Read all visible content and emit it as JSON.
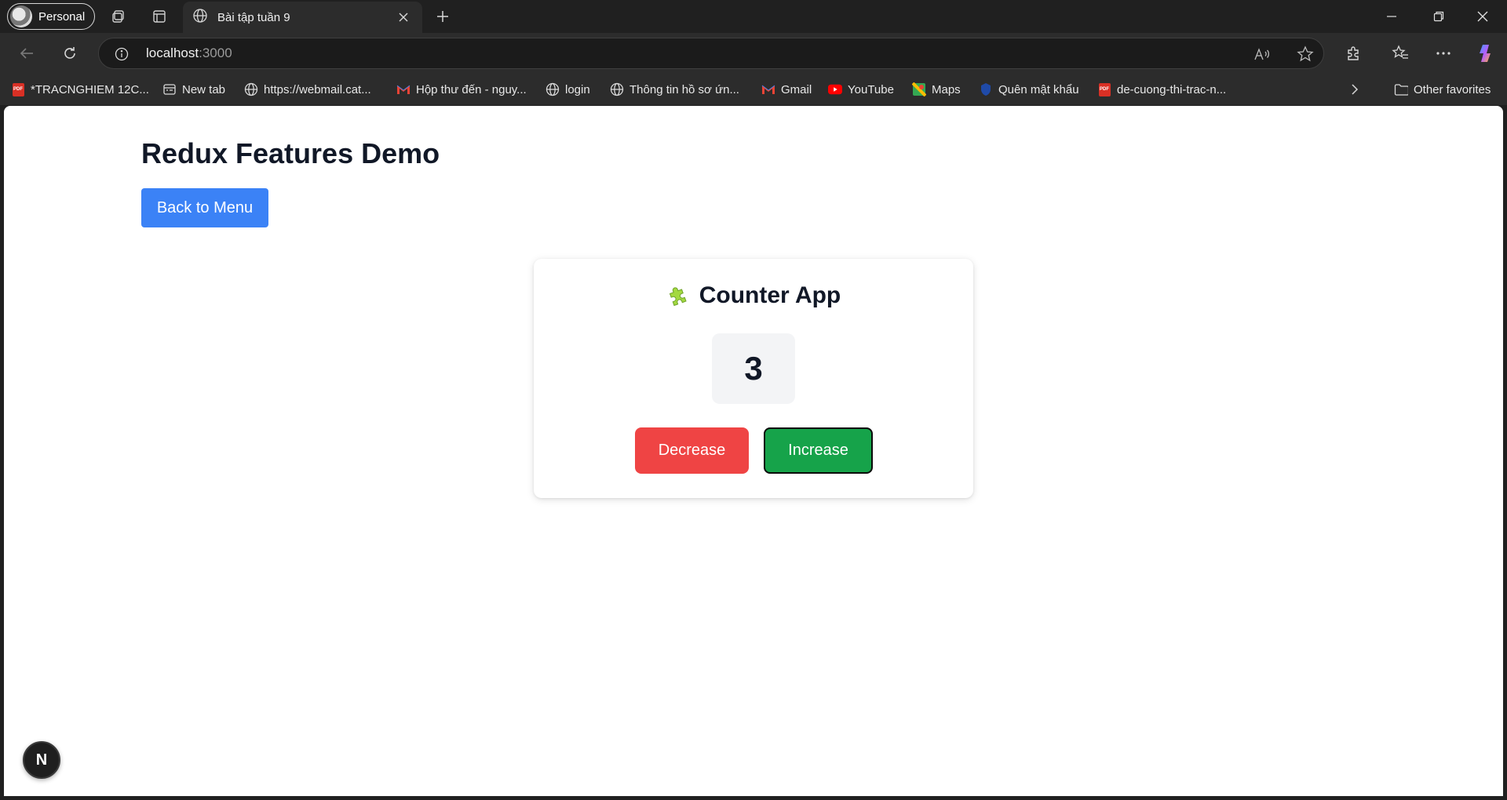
{
  "browser": {
    "profile_label": "Personal",
    "tab_title": "Bài tập tuần 9",
    "url_host": "localhost",
    "url_port": ":3000",
    "favorites": [
      {
        "label": "*TRACNGHIEM 12C...",
        "icon": "pdf-icon"
      },
      {
        "label": "New tab",
        "icon": "newtab-icon"
      },
      {
        "label": "https://webmail.cat...",
        "icon": "globe-icon"
      },
      {
        "label": "Hộp thư đến - nguy...",
        "icon": "gmail-icon"
      },
      {
        "label": "login",
        "icon": "globe-icon"
      },
      {
        "label": "Thông tin hồ sơ ứn...",
        "icon": "globe-icon"
      },
      {
        "label": "Gmail",
        "icon": "gmail-icon"
      },
      {
        "label": "YouTube",
        "icon": "youtube-icon"
      },
      {
        "label": "Maps",
        "icon": "maps-icon"
      },
      {
        "label": "Quên mật khẩu",
        "icon": "shield-icon"
      },
      {
        "label": "de-cuong-thi-trac-n...",
        "icon": "pdf-icon"
      }
    ],
    "other_favorites": "Other favorites"
  },
  "page": {
    "title": "Redux Features Demo",
    "back_button": "Back to Menu",
    "counter": {
      "title": "Counter App",
      "icon": "puzzle-icon",
      "value": "3",
      "decrease_label": "Decrease",
      "increase_label": "Increase"
    },
    "dev_badge": "N"
  },
  "colors": {
    "primary_blue": "#3b82f6",
    "danger_red": "#ef4444",
    "success_green": "#16a34a",
    "text_dark": "#111827",
    "counter_bg": "#f3f4f6"
  }
}
